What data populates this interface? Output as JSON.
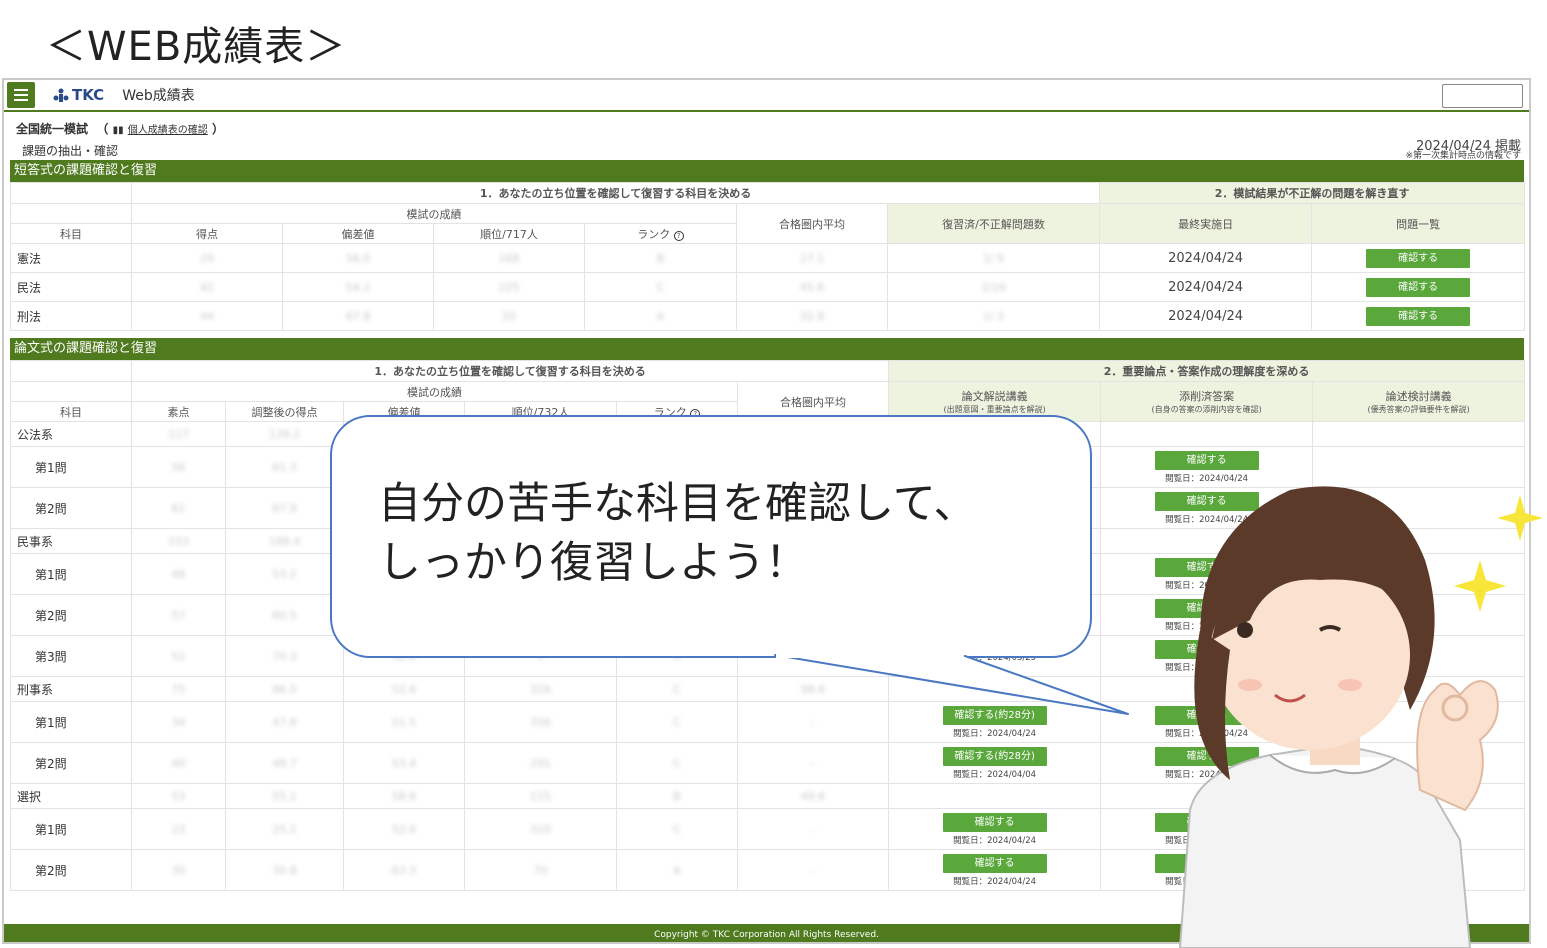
{
  "heading": "＜WEB成績表＞",
  "topbar": {
    "app_title": "Web成績表",
    "logo_text": "TKC"
  },
  "exam": {
    "title": "全国統一模試",
    "paren_open": "（",
    "link": "個人成績表の確認",
    "paren_close": "）",
    "sub": "課題の抽出・確認",
    "posted": "2024/04/24 掲載",
    "note": "※第一次集計時点の情報です"
  },
  "short": {
    "section": "短答式の課題確認と復習",
    "group1": "1．あなたの立ち位置を確認して復習する科目を決める",
    "group2": "2．模試結果が不正解の問題を解き直す",
    "subgroup": "模試の成績",
    "col_subject": "科目",
    "cols": [
      "得点",
      "偏差値",
      "順位/717人",
      "ランク"
    ],
    "col_avg": "合格圏内平均",
    "cols2": [
      "復習済/不正解問題数",
      "最終実施日",
      "問題一覧"
    ],
    "rows": [
      {
        "subject": "憲法",
        "score": "29",
        "dev": "56.0",
        "rank": "168",
        "grade": "B",
        "avg": "27.1",
        "review": "1/ 9",
        "date": "2024/04/24",
        "btn": "確認する"
      },
      {
        "subject": "民法",
        "score": "42",
        "dev": "54.2",
        "rank": "225",
        "grade": "C",
        "avg": "45.6",
        "review": "2/16",
        "date": "2024/04/24",
        "btn": "確認する"
      },
      {
        "subject": "刑法",
        "score": "44",
        "dev": "67.8",
        "rank": "20",
        "grade": "A",
        "avg": "32.8",
        "review": "1/ 2",
        "date": "2024/04/24",
        "btn": "確認する"
      }
    ]
  },
  "essay": {
    "section": "論文式の課題確認と復習",
    "group1": "1．あなたの立ち位置を確認して復習する科目を決める",
    "group2": "2．重要論点・答案作成の理解度を深める",
    "subgroup": "模試の成績",
    "col_subject": "科目",
    "cols": [
      "素点",
      "調整後の得点",
      "偏差値",
      "順位/732人",
      "ランク"
    ],
    "col_avg": "合格圏内平均",
    "cols2": [
      {
        "label": "論文解説講義",
        "sub": "(出題意図・重要論点を解説)"
      },
      {
        "label": "添削済答案",
        "sub": "(自身の答案の添削内容を確認)"
      },
      {
        "label": "論述検討講義",
        "sub": "(優秀答案の評価要件を解説)"
      }
    ],
    "rows": [
      {
        "subject": "公法系",
        "indent": false,
        "cells": [
          "117",
          "139.2",
          "",
          "",
          "",
          ""
        ],
        "lec": "",
        "lec_date": "",
        "ans": "",
        "ans_date": ""
      },
      {
        "subject": "第1問",
        "indent": true,
        "cells": [
          "56",
          "61.3",
          "",
          "",
          "",
          ""
        ],
        "lec": "",
        "lec_date": "",
        "ans": "確認する",
        "ans_date": "閲覧日：2024/04/24"
      },
      {
        "subject": "第2問",
        "indent": true,
        "cells": [
          "61",
          "67.9",
          "",
          "",
          "",
          ""
        ],
        "lec": "",
        "lec_date": "",
        "ans": "確認する",
        "ans_date": "閲覧日：2024/04/24"
      },
      {
        "subject": "民事系",
        "indent": false,
        "cells": [
          "153",
          "188.4",
          "",
          "",
          "",
          ""
        ],
        "lec": "",
        "lec_date": "",
        "ans": "",
        "ans_date": ""
      },
      {
        "subject": "第1問",
        "indent": true,
        "cells": [
          "48",
          "53.2",
          "",
          "",
          "",
          ""
        ],
        "lec": "",
        "lec_date": "",
        "ans": "確認する",
        "ans_date": "閲覧日：2024/04/24"
      },
      {
        "subject": "第2問",
        "indent": true,
        "cells": [
          "57",
          "60.5",
          "",
          "",
          "",
          ""
        ],
        "lec": "",
        "lec_date": "",
        "ans": "確認する",
        "ans_date": "閲覧日：2024/04/24"
      },
      {
        "subject": "第3問",
        "indent": true,
        "cells": [
          "51",
          "70.3",
          "52.8",
          "9",
          "A",
          ""
        ],
        "lec": "",
        "lec_date": "閲覧日：2024/03/25",
        "ans": "確認する",
        "ans_date": "閲覧日：2024/04/24"
      },
      {
        "subject": "刑事系",
        "indent": false,
        "cells": [
          "75",
          "86.5",
          "52.6",
          "326",
          "C",
          "98.6"
        ],
        "lec": "",
        "lec_date": "",
        "ans": "",
        "ans_date": ""
      },
      {
        "subject": "第1問",
        "indent": true,
        "cells": [
          "34",
          "47.8",
          "51.5",
          "356",
          "C",
          "-"
        ],
        "lec": "確認する(約28分)",
        "lec_date": "閲覧日：2024/04/24",
        "ans": "確認する",
        "ans_date": "閲覧日：2024/04/24"
      },
      {
        "subject": "第2問",
        "indent": true,
        "cells": [
          "40",
          "48.7",
          "53.4",
          "291",
          "C",
          "-"
        ],
        "lec": "確認する(約28分)",
        "lec_date": "閲覧日：2024/04/04",
        "ans": "確認する",
        "ans_date": "閲覧日：2024/04/24"
      },
      {
        "subject": "選択",
        "indent": false,
        "cells": [
          "53",
          "55.1",
          "58.6",
          "115",
          "B",
          "49.6"
        ],
        "lec": "",
        "lec_date": "",
        "ans": "",
        "ans_date": ""
      },
      {
        "subject": "第1問",
        "indent": true,
        "cells": [
          "23",
          "25.1",
          "52.6",
          "310",
          "C",
          "-"
        ],
        "lec": "確認する",
        "lec_date": "閲覧日：2024/04/24",
        "ans": "確認する",
        "ans_date": "閲覧日：2024/04/24"
      },
      {
        "subject": "第2問",
        "indent": true,
        "cells": [
          "30",
          "30.8",
          "63.3",
          "70",
          "A",
          "-"
        ],
        "lec": "確認する",
        "lec_date": "閲覧日：2024/04/24",
        "ans": "確認する",
        "ans_date": "閲覧日：2024/04/24"
      }
    ]
  },
  "footer": "Copyright © TKC Corporation All Rights Reserved.",
  "bubble": {
    "line1": "自分の苦手な科目を確認して、",
    "line2": "しっかり復習しよう！"
  },
  "colors": {
    "brand_green": "#4f7a1e",
    "button_green": "#5aa73b",
    "bubble_border": "#4a78c2"
  }
}
